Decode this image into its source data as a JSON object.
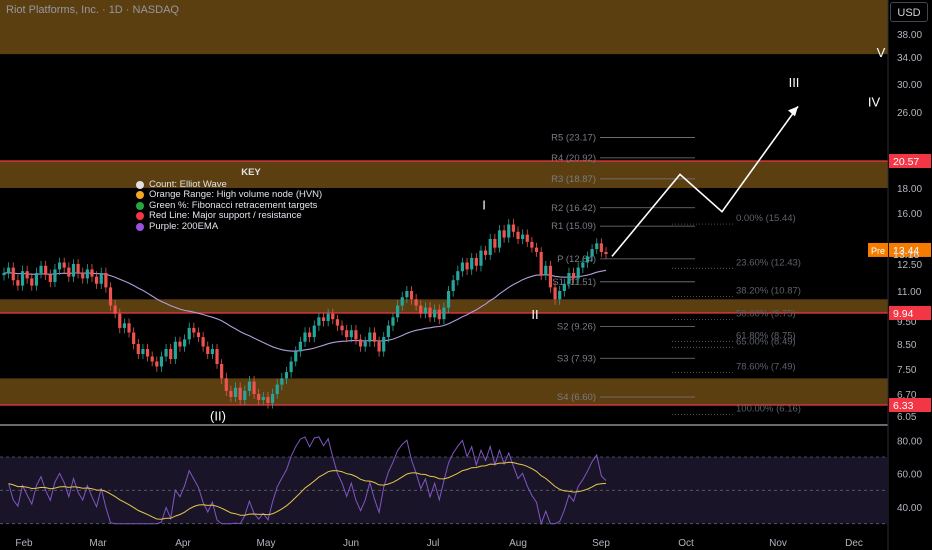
{
  "header": {
    "title": "Riot Platforms, Inc. · 1D · NASDAQ",
    "currency": "USD"
  },
  "key": {
    "title": "KEY",
    "items": [
      {
        "label": "Count: Elliot Wave",
        "color": "#e0e0e0"
      },
      {
        "label": "Orange Range: High volume node (HVN)",
        "color": "#f5a623"
      },
      {
        "label": "Green %: Fibonacci retracement targets",
        "color": "#26a641"
      },
      {
        "label": "Red Line: Major support / resistance",
        "color": "#f23645"
      },
      {
        "label": "Purple: 200EMA",
        "color": "#9b51e0"
      }
    ]
  },
  "colors": {
    "up": "#26a69a",
    "down": "#ef5350",
    "hvn": "#6b4a14",
    "redline": "#f23645",
    "ema": "#b39ddb",
    "rsi": "#7e57c2",
    "rsi_ma": "#e6c84a",
    "pre": "#f57c00"
  },
  "chart_data": {
    "type": "candlestick",
    "x_ticks": [
      "Feb",
      "Mar",
      "Apr",
      "May",
      "Jun",
      "Jul",
      "Aug",
      "Sep",
      "Oct",
      "Nov",
      "Dec"
    ],
    "y_ticks": [
      38.0,
      34.0,
      30.0,
      26.0,
      20.57,
      18.0,
      16.0,
      13.16,
      12.5,
      11.0,
      9.94,
      9.5,
      8.5,
      7.5,
      6.7,
      6.33,
      6.05
    ],
    "price_badges": [
      {
        "value": "20.57",
        "color": "#f23645"
      },
      {
        "value": "13.44",
        "color": "#f57c00",
        "prefix": "Pre"
      },
      {
        "value": "13.16",
        "color": "none"
      },
      {
        "value": "9.94",
        "color": "#f23645"
      },
      {
        "value": "6.33",
        "color": "#f23645"
      }
    ],
    "hvn_zones": [
      [
        34.5,
        45.0
      ],
      [
        18.0,
        20.57
      ],
      [
        9.94,
        10.6
      ],
      [
        6.33,
        7.2
      ]
    ],
    "support_resistance": [
      20.57,
      9.94,
      6.33
    ],
    "pivots": [
      {
        "label": "R5 (23.17)",
        "value": 23.17
      },
      {
        "label": "R4 (20.92)",
        "value": 20.92
      },
      {
        "label": "R3 (18.87)",
        "value": 18.87
      },
      {
        "label": "R2 (16.42)",
        "value": 16.42
      },
      {
        "label": "R1 (15.09)",
        "value": 15.09
      },
      {
        "label": "P (12.84)",
        "value": 12.84
      },
      {
        "label": "S1 (11.51)",
        "value": 11.51
      },
      {
        "label": "S2 (9.26)",
        "value": 9.26
      },
      {
        "label": "S3 (7.93)",
        "value": 7.93
      },
      {
        "label": "S4 (6.60)",
        "value": 6.6
      }
    ],
    "fibs": [
      {
        "label": "0.00% (15.44)",
        "value": 15.44
      },
      {
        "label": "23.60% (12.43)",
        "value": 12.43
      },
      {
        "label": "38.20% (10.87)",
        "value": 10.87
      },
      {
        "label": "50.00% (9.75)",
        "value": 9.75
      },
      {
        "label": "61.80% (8.75)",
        "value": 8.75
      },
      {
        "label": "65.00% (8.49)",
        "value": 8.49
      },
      {
        "label": "78.60% (7.49)",
        "value": 7.49
      },
      {
        "label": "100.00% (6.16)",
        "value": 6.16
      }
    ],
    "wave_labels": [
      "(II)",
      "I",
      "II",
      "III",
      "IV",
      "V"
    ],
    "rsi": {
      "y_ticks": [
        80.0,
        60.0,
        40.0
      ],
      "upper": 70,
      "lower": 30,
      "mid": 50
    },
    "closes": [
      12.0,
      12.3,
      11.6,
      11.3,
      12.1,
      11.7,
      11.3,
      12.0,
      12.4,
      11.9,
      11.5,
      12.2,
      12.6,
      12.3,
      11.8,
      12.5,
      12.0,
      11.7,
      12.2,
      11.8,
      11.4,
      12.0,
      11.2,
      10.3,
      9.9,
      9.2,
      9.4,
      9.0,
      8.5,
      8.1,
      8.3,
      8.0,
      7.8,
      7.6,
      8.0,
      8.3,
      7.9,
      8.6,
      8.4,
      8.7,
      9.2,
      9.0,
      8.8,
      8.4,
      8.1,
      8.3,
      7.7,
      7.2,
      6.8,
      6.6,
      6.9,
      6.5,
      6.8,
      7.1,
      6.7,
      6.5,
      6.6,
      6.4,
      6.7,
      7.0,
      7.2,
      7.4,
      7.8,
      8.2,
      8.6,
      9.0,
      8.8,
      9.3,
      9.7,
      9.5,
      9.9,
      9.6,
      9.3,
      9.1,
      8.8,
      9.1,
      8.7,
      8.4,
      8.6,
      9.0,
      8.6,
      8.2,
      8.8,
      9.3,
      9.7,
      10.3,
      10.7,
      11.0,
      10.6,
      10.3,
      9.9,
      10.2,
      9.7,
      10.1,
      9.6,
      10.2,
      11.0,
      11.6,
      12.1,
      12.6,
      12.2,
      12.9,
      12.4,
      13.4,
      13.1,
      14.2,
      13.6,
      14.8,
      14.3,
      15.2,
      14.7,
      14.2,
      14.5,
      14.0,
      13.6,
      13.3,
      11.9,
      12.4,
      11.2,
      10.6,
      11.0,
      11.4,
      12.0,
      11.7,
      12.3,
      12.6,
      13.0,
      13.5,
      13.9,
      13.3,
      13.16
    ]
  }
}
